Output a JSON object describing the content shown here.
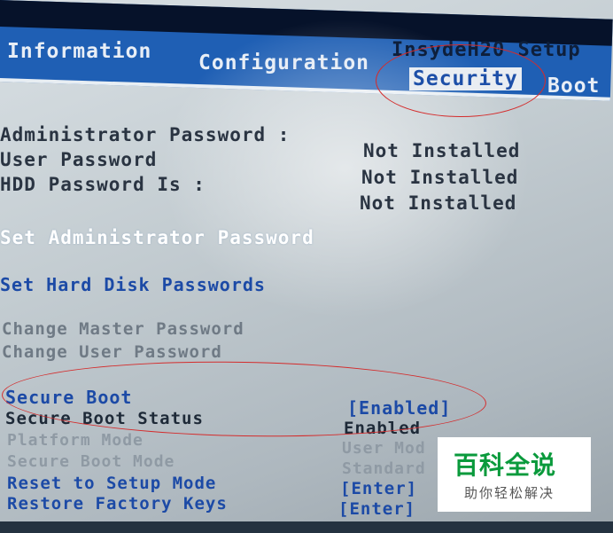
{
  "header": {
    "brand": "InsydeH20 Setup",
    "tabs": [
      {
        "label": "Information",
        "active": false
      },
      {
        "label": "Configuration",
        "active": false
      },
      {
        "label": "Security",
        "active": true
      },
      {
        "label": "Boot",
        "active": false
      }
    ]
  },
  "status": {
    "admin_password_label": "Administrator Password :",
    "admin_password_value": "Not Installed",
    "user_password_label": "User Password",
    "user_password_value": "Not Installed",
    "hdd_password_label": "HDD Password Is :",
    "hdd_password_value": "Not Installed"
  },
  "actions": {
    "set_admin": "Set Administrator Password",
    "set_hdd": "Set Hard Disk Passwords",
    "change_master": "Change Master Password",
    "change_user": "Change User Password"
  },
  "secure_boot": {
    "label": "Secure Boot",
    "value": "[Enabled]",
    "status_label": "Secure Boot Status",
    "status_value": "Enabled",
    "platform_mode_label": "Platform Mode",
    "platform_mode_value": "User Mod",
    "boot_mode_label": "Secure Boot Mode",
    "boot_mode_value": "Standard",
    "reset_label": "Reset to Setup Mode",
    "reset_value": "[Enter]",
    "restore_label": "Restore Factory Keys",
    "restore_value": "[Enter]"
  },
  "watermark": {
    "title": "百科全说",
    "subtitle": "助你轻松解决"
  },
  "colors": {
    "menu_bar": "#1f5fb4",
    "active_tab_bg": "#e9edf2",
    "annotation": "#d42c2c",
    "watermark_green": "#0a9a3c"
  }
}
